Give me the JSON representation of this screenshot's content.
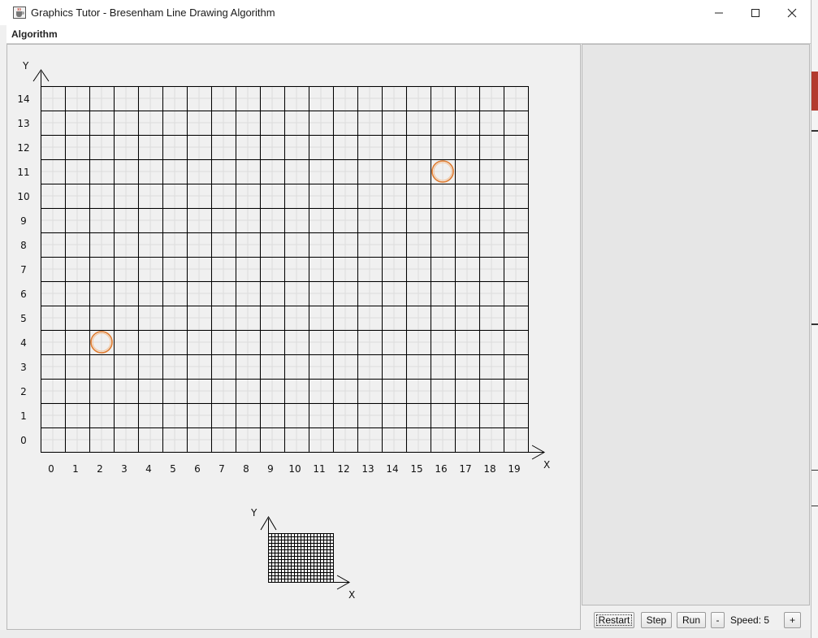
{
  "window": {
    "title": "Graphics Tutor - Bresenham Line Drawing Algorithm",
    "icons": {
      "app": "java-cup-icon",
      "minimize": "minimize-icon",
      "maximize": "maximize-icon",
      "close": "close-icon"
    }
  },
  "menu": {
    "items": [
      {
        "label": "Algorithm"
      }
    ]
  },
  "grid": {
    "x_axis_label": "X",
    "y_axis_label": "Y",
    "x_ticks": [
      "0",
      "1",
      "2",
      "3",
      "4",
      "5",
      "6",
      "7",
      "8",
      "9",
      "10",
      "11",
      "12",
      "13",
      "14",
      "15",
      "16",
      "17",
      "18",
      "19"
    ],
    "y_ticks": [
      "14",
      "13",
      "12",
      "11",
      "10",
      "9",
      "8",
      "7",
      "6",
      "5",
      "4",
      "3",
      "2",
      "1",
      "0"
    ],
    "columns": 20,
    "rows": 15,
    "endpoints": [
      {
        "name": "start-point",
        "x": 2,
        "y": 4
      },
      {
        "name": "end-point",
        "x": 16,
        "y": 11
      }
    ],
    "endpoint_color": "#e07a2c",
    "grid_color": "#000000"
  },
  "minimap": {
    "x_axis_label": "X",
    "y_axis_label": "Y"
  },
  "controls": {
    "restart_label": "Restart",
    "step_label": "Step",
    "run_label": "Run",
    "decrease_label": "-",
    "speed_label": "Speed: 5",
    "increase_label": "+"
  }
}
